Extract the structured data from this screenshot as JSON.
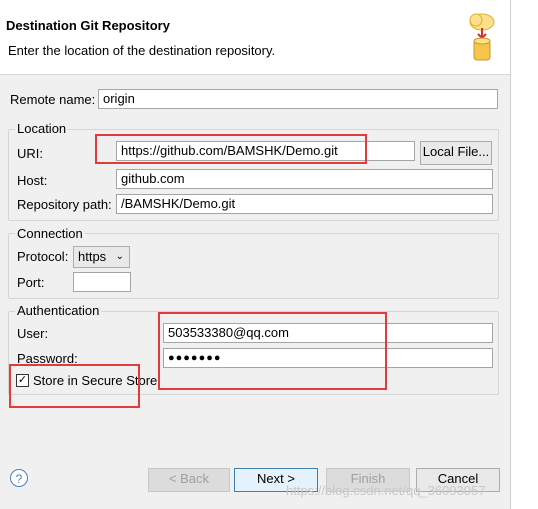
{
  "header": {
    "title": "Destination Git Repository",
    "subtitle": "Enter the location of the destination repository."
  },
  "remote": {
    "label": "Remote name:",
    "value": "origin"
  },
  "location": {
    "group_title": "Location",
    "uri_label": "URI:",
    "uri_value": "https://github.com/BAMSHK/Demo.git",
    "local_file_button": "Local File...",
    "host_label": "Host:",
    "host_value": "github.com",
    "path_label": "Repository path:",
    "path_value": "/BAMSHK/Demo.git"
  },
  "connection": {
    "group_title": "Connection",
    "protocol_label": "Protocol:",
    "protocol_value": "https",
    "port_label": "Port:",
    "port_value": ""
  },
  "authentication": {
    "group_title": "Authentication",
    "user_label": "User:",
    "user_value": "503533380@qq.com",
    "password_label": "Password:",
    "password_value": "●●●●●●●",
    "store_label": "Store in Secure Store",
    "store_checked": true
  },
  "buttons": {
    "help": "?",
    "back": "< Back",
    "next": "Next >",
    "finish": "Finish",
    "cancel": "Cancel"
  },
  "watermark": "https://blog.csdn.net/qq_36093057",
  "colors": {
    "highlight": "#e03c3c",
    "header_bg": "#ffffff",
    "dialog_bg": "#f0f0f0"
  }
}
